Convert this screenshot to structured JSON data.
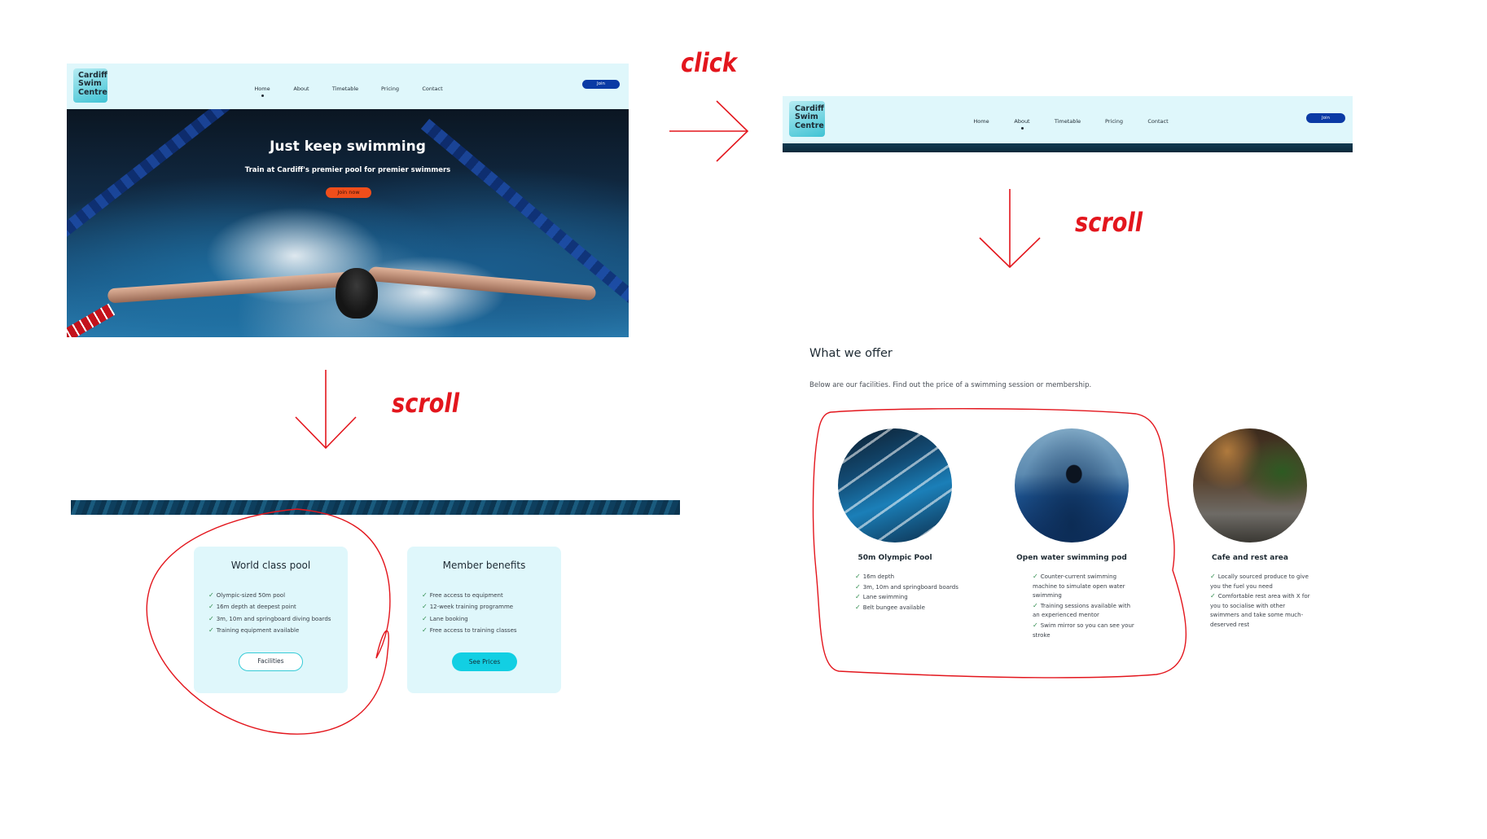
{
  "brand": {
    "logo_lines": [
      "Cardiff",
      "Swim",
      "Centre"
    ]
  },
  "nav": {
    "items": [
      "Home",
      "About",
      "Timetable",
      "Pricing",
      "Contact"
    ],
    "join_label": "Join"
  },
  "frames": {
    "home": {
      "active_item": "Home"
    },
    "about": {
      "active_item": "About"
    }
  },
  "hero": {
    "title": "Just keep swimming",
    "subtitle": "Train at Cardiff's premier pool for premier swimmers",
    "cta_label": "Join now"
  },
  "cards": [
    {
      "title": "World class pool",
      "items": [
        "Olympic-sized 50m pool",
        "16m depth at deepest point",
        "3m, 10m and springboard diving boards",
        "Training equipment available"
      ],
      "button_label": "Facilities",
      "button_style": "outline"
    },
    {
      "title": "Member benefits",
      "items": [
        "Free access to equipment",
        "12-week training programme",
        "Lane booking",
        "Free access to training classes"
      ],
      "button_label": "See Prices",
      "button_style": "filled"
    }
  ],
  "offer": {
    "title": "What we offer",
    "subtitle": "Below are our facilities. Find out the price of a swimming session or membership.",
    "facilities": [
      {
        "title": "50m Olympic Pool",
        "image": "pool-lanes-photo",
        "items": [
          "16m depth",
          "3m, 10m and springboard boards",
          "Lane swimming",
          "Belt bungee available"
        ]
      },
      {
        "title": "Open water swimming pod",
        "image": "open-water-swimmer-photo",
        "items": [
          "Counter-current swimming machine to simulate open water swimming",
          "Training sessions available with an experienced mentor",
          "Swim mirror so you can see your stroke"
        ]
      },
      {
        "title": "Cafe and rest area",
        "image": "cafe-interior-photo",
        "items": [
          "Locally sourced produce to give you the fuel you need",
          "Comfortable rest area with X for you to socialise with other swimmers and take some much-deserved rest"
        ]
      }
    ]
  },
  "annotations": {
    "click": "click",
    "scroll_right": "scroll",
    "scroll_left": "scroll"
  },
  "colors": {
    "nav_bg": "#dff7fb",
    "join_button": "#0b3aa5",
    "hero_cta": "#f04e1b",
    "accent_cyan": "#12cfe3",
    "check_green": "#2e8b4c",
    "annotation_red": "#e3161d"
  }
}
